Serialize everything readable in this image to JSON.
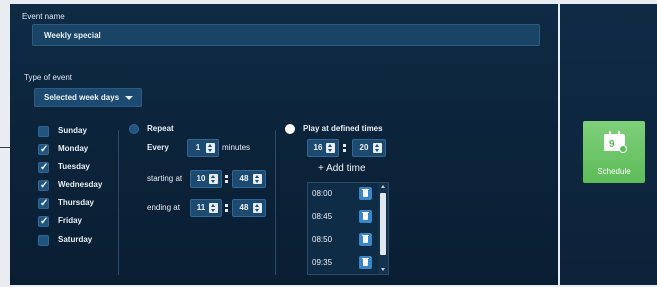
{
  "event_name": {
    "label": "Event name",
    "value": "Weekly special"
  },
  "event_type": {
    "label": "Type of event",
    "selected": "Selected week days"
  },
  "days": [
    {
      "label": "Sunday",
      "checked": false
    },
    {
      "label": "Monday",
      "checked": true
    },
    {
      "label": "Tuesday",
      "checked": true
    },
    {
      "label": "Wednesday",
      "checked": true
    },
    {
      "label": "Thursday",
      "checked": true
    },
    {
      "label": "Friday",
      "checked": true
    },
    {
      "label": "Saturday",
      "checked": false
    }
  ],
  "repeat": {
    "label": "Repeat",
    "selected": false,
    "every_label": "Every",
    "every_value": "1",
    "every_unit": "minutes",
    "starting_label": "starting at",
    "start_hour": "10",
    "start_minute": "48",
    "ending_label": "ending at",
    "end_hour": "11",
    "end_minute": "48"
  },
  "defined_times": {
    "label": "Play at defined times",
    "selected": true,
    "hour": "16",
    "minute": "20",
    "add_label": "+  Add time",
    "times": [
      "08:00",
      "08:45",
      "08:50",
      "09:35"
    ]
  },
  "schedule_button": {
    "label": "Schedule",
    "icon": "calendar-icon",
    "icon_number": "9"
  },
  "colors": {
    "panel": "#0e2a44",
    "accent_green": "#5dbb58",
    "accent_blue": "#3a86c8"
  }
}
